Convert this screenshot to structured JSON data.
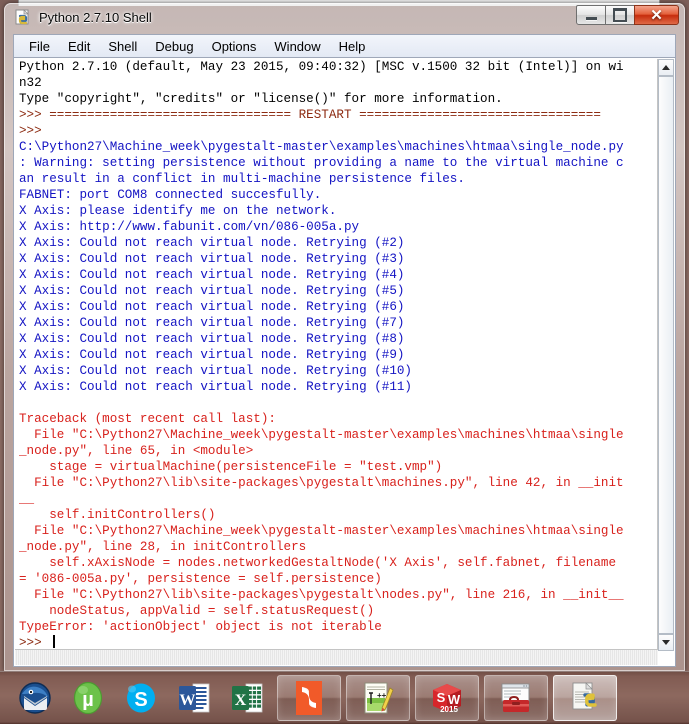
{
  "window": {
    "title": "Python 2.7.10 Shell",
    "icon": "python-idle-icon",
    "controls": {
      "minimize": "minimize-button",
      "maximize": "maximize-button",
      "close_glyph": "✕"
    }
  },
  "menu": {
    "items": [
      {
        "label": "File"
      },
      {
        "label": "Edit"
      },
      {
        "label": "Shell"
      },
      {
        "label": "Debug"
      },
      {
        "label": "Options"
      },
      {
        "label": "Window"
      },
      {
        "label": "Help"
      }
    ]
  },
  "shell": {
    "lines": [
      {
        "color": "black",
        "text": "Python 2.7.10 (default, May 23 2015, 09:40:32) [MSC v.1500 32 bit (Intel)] on wi"
      },
      {
        "color": "black",
        "text": "n32"
      },
      {
        "color": "black",
        "text": "Type \"copyright\", \"credits\" or \"license()\" for more information."
      },
      {
        "color": "maroon",
        "text": ">>> ================================ RESTART ================================"
      },
      {
        "color": "maroon",
        "text": ">>> "
      },
      {
        "color": "blue",
        "text": "C:\\Python27\\Machine_week\\pygestalt-master\\examples\\machines\\htmaa\\single_node.py"
      },
      {
        "color": "blue",
        "text": ": Warning: setting persistence without providing a name to the virtual machine c"
      },
      {
        "color": "blue",
        "text": "an result in a conflict in multi-machine persistence files."
      },
      {
        "color": "blue",
        "text": "FABNET: port COM8 connected succesfully."
      },
      {
        "color": "blue",
        "text": "X Axis: please identify me on the network."
      },
      {
        "color": "blue",
        "text": "X Axis: http://www.fabunit.com/vn/086-005a.py"
      },
      {
        "color": "blue",
        "text": "X Axis: Could not reach virtual node. Retrying (#2)"
      },
      {
        "color": "blue",
        "text": "X Axis: Could not reach virtual node. Retrying (#3)"
      },
      {
        "color": "blue",
        "text": "X Axis: Could not reach virtual node. Retrying (#4)"
      },
      {
        "color": "blue",
        "text": "X Axis: Could not reach virtual node. Retrying (#5)"
      },
      {
        "color": "blue",
        "text": "X Axis: Could not reach virtual node. Retrying (#6)"
      },
      {
        "color": "blue",
        "text": "X Axis: Could not reach virtual node. Retrying (#7)"
      },
      {
        "color": "blue",
        "text": "X Axis: Could not reach virtual node. Retrying (#8)"
      },
      {
        "color": "blue",
        "text": "X Axis: Could not reach virtual node. Retrying (#9)"
      },
      {
        "color": "blue",
        "text": "X Axis: Could not reach virtual node. Retrying (#10)"
      },
      {
        "color": "blue",
        "text": "X Axis: Could not reach virtual node. Retrying (#11)"
      },
      {
        "color": "black",
        "text": ""
      },
      {
        "color": "red",
        "text": "Traceback (most recent call last):"
      },
      {
        "color": "red",
        "text": "  File \"C:\\Python27\\Machine_week\\pygestalt-master\\examples\\machines\\htmaa\\single"
      },
      {
        "color": "red",
        "text": "_node.py\", line 65, in <module>"
      },
      {
        "color": "red",
        "text": "    stage = virtualMachine(persistenceFile = \"test.vmp\")"
      },
      {
        "color": "red",
        "text": "  File \"C:\\Python27\\lib\\site-packages\\pygestalt\\machines.py\", line 42, in __init"
      },
      {
        "color": "red",
        "text": "__"
      },
      {
        "color": "red",
        "text": "    self.initControllers()"
      },
      {
        "color": "red",
        "text": "  File \"C:\\Python27\\Machine_week\\pygestalt-master\\examples\\machines\\htmaa\\single"
      },
      {
        "color": "red",
        "text": "_node.py\", line 28, in initControllers"
      },
      {
        "color": "red",
        "text": "    self.xAxisNode = nodes.networkedGestaltNode('X Axis', self.fabnet, filename"
      },
      {
        "color": "red",
        "text": "= '086-005a.py', persistence = self.persistence)"
      },
      {
        "color": "red",
        "text": "  File \"C:\\Python27\\lib\\site-packages\\pygestalt\\nodes.py\", line 216, in __init__"
      },
      {
        "color": "red",
        "text": "    nodeStatus, appValid = self.statusRequest()"
      },
      {
        "color": "red",
        "text": "TypeError: 'actionObject' object is not iterable"
      }
    ],
    "prompt": ">>> ",
    "prompt_color": "maroon"
  },
  "scrollbars": {
    "vertical_up": "scroll-up-arrow",
    "vertical_down": "scroll-down-arrow"
  },
  "taskbar": {
    "quick_launch": [
      {
        "name": "thunderbird-icon",
        "label": "Mozilla Thunderbird"
      },
      {
        "name": "utorrent-icon",
        "label": "µTorrent"
      },
      {
        "name": "skype-icon",
        "label": "Skype",
        "glyph": "S"
      },
      {
        "name": "word-icon",
        "label": "Microsoft Word",
        "glyph": "W"
      },
      {
        "name": "excel-icon",
        "label": "Microsoft Excel",
        "glyph": "X"
      }
    ],
    "tasks": [
      {
        "name": "nitro-pdf-task",
        "label": "Nitro PDF",
        "active": false
      },
      {
        "name": "notepadpp-task",
        "label": "Notepad++",
        "active": false
      },
      {
        "name": "solidworks-task",
        "label": "SolidWorks",
        "glyph": "SW",
        "year": "2015",
        "active": false
      },
      {
        "name": "toolbox-task",
        "label": "Toolbox",
        "active": false
      },
      {
        "name": "python-shell-task",
        "label": "Python 2.7.10 Shell",
        "active": true
      }
    ]
  },
  "colors": {
    "text_black": "#000000",
    "text_blue": "#1313c3",
    "text_red": "#d8211c",
    "text_maroon": "#8c2a10",
    "taskbar": "#8d6a60",
    "close_button": "#c62c0c"
  }
}
